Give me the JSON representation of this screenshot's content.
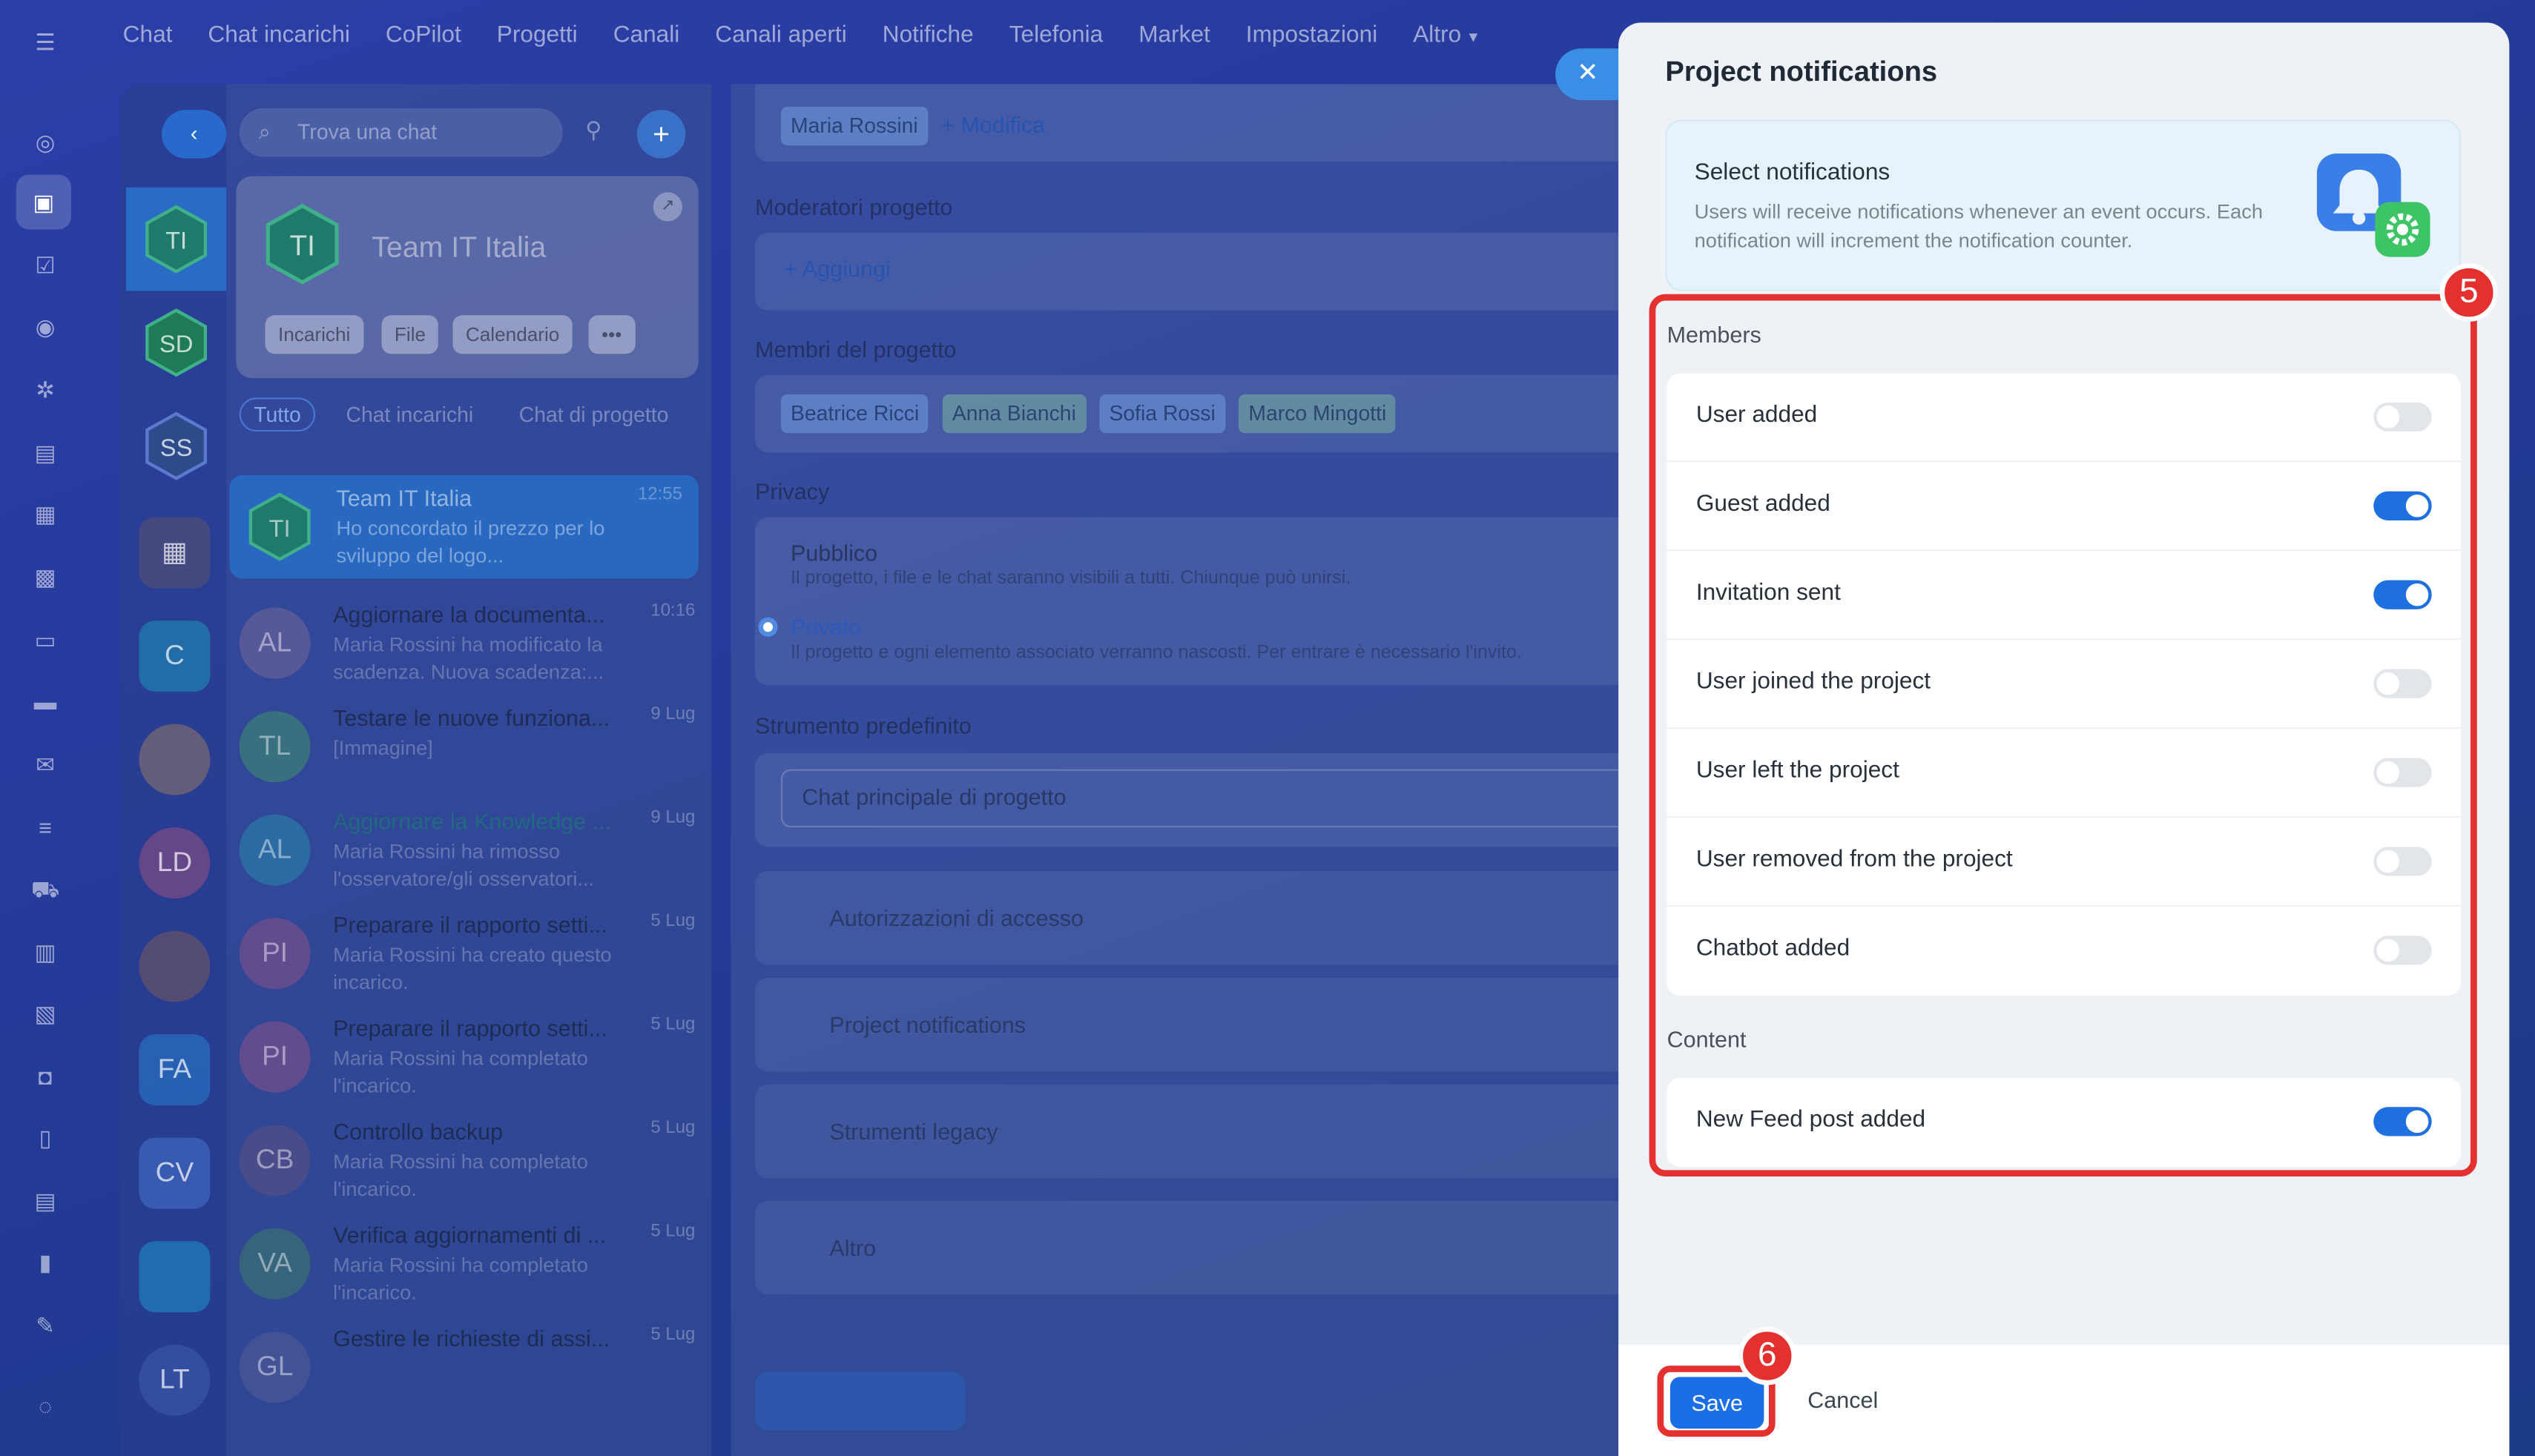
{
  "topnav": [
    "Chat",
    "Chat incarichi",
    "CoPilot",
    "Progetti",
    "Canali",
    "Canali aperti",
    "Notifiche",
    "Telefonia",
    "Market",
    "Impostazioni",
    "Altro"
  ],
  "sidebar_list": {
    "search_placeholder": "Trova una chat",
    "team_card": {
      "initials": "TI",
      "name": "Team IT Italia",
      "chips": [
        "Incarichi",
        "File",
        "Calendario",
        "•••"
      ]
    },
    "filters": [
      "Tutto",
      "Chat incarichi",
      "Chat di progetto"
    ],
    "chats": [
      {
        "initials": "TI",
        "title": "Team IT Italia",
        "snippet": "Ho concordato il prezzo per lo sviluppo del logo...",
        "date": "12:55"
      },
      {
        "initials": "AL",
        "title": "Aggiornare la documenta...",
        "snippet": "Maria Rossini ha modificato la scadenza. Nuova scadenza:...",
        "date": "10:16"
      },
      {
        "initials": "TL",
        "title": "Testare le nuove funziona...",
        "snippet": "[Immagine]",
        "date": "9 Lug"
      },
      {
        "initials": "AL",
        "title": "Aggiornare la Knowledge ...",
        "snippet": "Maria Rossini ha rimosso l'osservatore/gli osservatori...",
        "date": "9 Lug"
      },
      {
        "initials": "PI",
        "title": "Preparare il rapporto setti...",
        "snippet": "Maria Rossini ha creato questo incarico.",
        "date": "5 Lug"
      },
      {
        "initials": "PI",
        "title": "Preparare il rapporto setti...",
        "snippet": "Maria Rossini ha completato l'incarico.",
        "date": "5 Lug"
      },
      {
        "initials": "CB",
        "title": "Controllo backup",
        "snippet": "Maria Rossini ha completato l'incarico.",
        "date": "5 Lug"
      },
      {
        "initials": "VA",
        "title": "Verifica aggiornamenti di ...",
        "snippet": "Maria Rossini ha completato l'incarico.",
        "date": "5 Lug"
      },
      {
        "initials": "GL",
        "title": "Gestire le richieste di assi...",
        "snippet": "",
        "date": "5 Lug"
      }
    ]
  },
  "rail_avatars": [
    "TI",
    "SD",
    "SS",
    "",
    "C",
    "",
    "LD",
    "",
    "FA",
    "CV",
    "",
    "LT"
  ],
  "main": {
    "owner_pill": "Maria Rossini",
    "modify_link": "+ Modifica",
    "moderators_label": "Moderatori progetto",
    "add_link": "+ Aggiungi",
    "members_label": "Membri del progetto",
    "members": [
      "Beatrice Ricci",
      "Anna Bianchi",
      "Sofia Rossi",
      "Marco Mingotti"
    ],
    "privacy_label": "Privacy",
    "public_title": "Pubblico",
    "public_desc": "Il progetto, i file e le chat saranno visibili a tutti. Chiunque può unirsi.",
    "private_title": "Privato",
    "private_desc": "Il progetto e ogni elemento associato verranno nascosti. Per entrare è necessario l'invito.",
    "tool_label": "Strumento predefinito",
    "tool_value": "Chat principale di progetto",
    "nav_rows": [
      "Autorizzazioni di accesso",
      "Project notifications",
      "Strumenti legacy",
      "Altro"
    ]
  },
  "panel": {
    "title": "Project notifications",
    "info": {
      "heading": "Select notifications",
      "text": "Users will receive notifications whenever an event occurs. Each notification will increment the notification counter."
    },
    "members_section": "Members",
    "member_rows": [
      {
        "label": "User added",
        "on": false
      },
      {
        "label": "Guest added",
        "on": true
      },
      {
        "label": "Invitation sent",
        "on": true
      },
      {
        "label": "User joined the project",
        "on": false
      },
      {
        "label": "User left the project",
        "on": false
      },
      {
        "label": "User removed from the project",
        "on": false
      },
      {
        "label": "Chatbot added",
        "on": false
      }
    ],
    "content_section": "Content",
    "content_rows": [
      {
        "label": "New Feed post added",
        "on": true
      }
    ],
    "save_label": "Save",
    "cancel_label": "Cancel",
    "badge_5": "5",
    "badge_6": "6"
  },
  "colors": {
    "accent": "#1e6fe0",
    "annotation": "#e53030",
    "panel_bg": "#eef1f5"
  }
}
